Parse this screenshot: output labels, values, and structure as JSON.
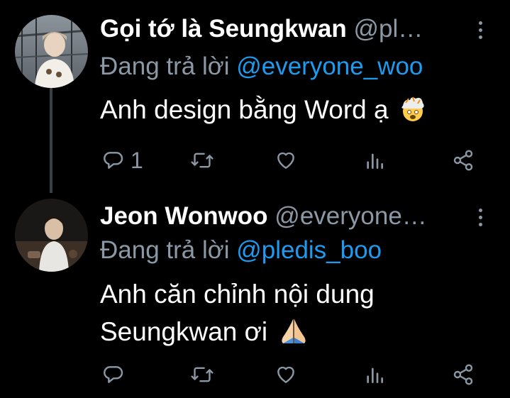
{
  "tweets": [
    {
      "display_name": "Gọi tớ là Seungkwan",
      "handle": "@pl…",
      "reply_prefix": "Đang trả lời",
      "reply_to": "@everyone_woo",
      "text": "Anh design bằng Word ạ",
      "emoji": "exploding-head-icon",
      "reply_count": "1"
    },
    {
      "display_name": "Jeon Wonwoo",
      "handle": "@everyone…",
      "reply_prefix": "Đang trả lời",
      "reply_to": "@pledis_boo",
      "text_line1": "Anh căn chỉnh nội dung",
      "text_line2": "Seungkwan ơi",
      "emoji": "folded-hands-icon",
      "reply_count": ""
    }
  ],
  "colors": {
    "background": "#000000",
    "secondary_text": "#8b98a5",
    "link": "#1d9bf0",
    "thread_line": "#3a3f44"
  }
}
